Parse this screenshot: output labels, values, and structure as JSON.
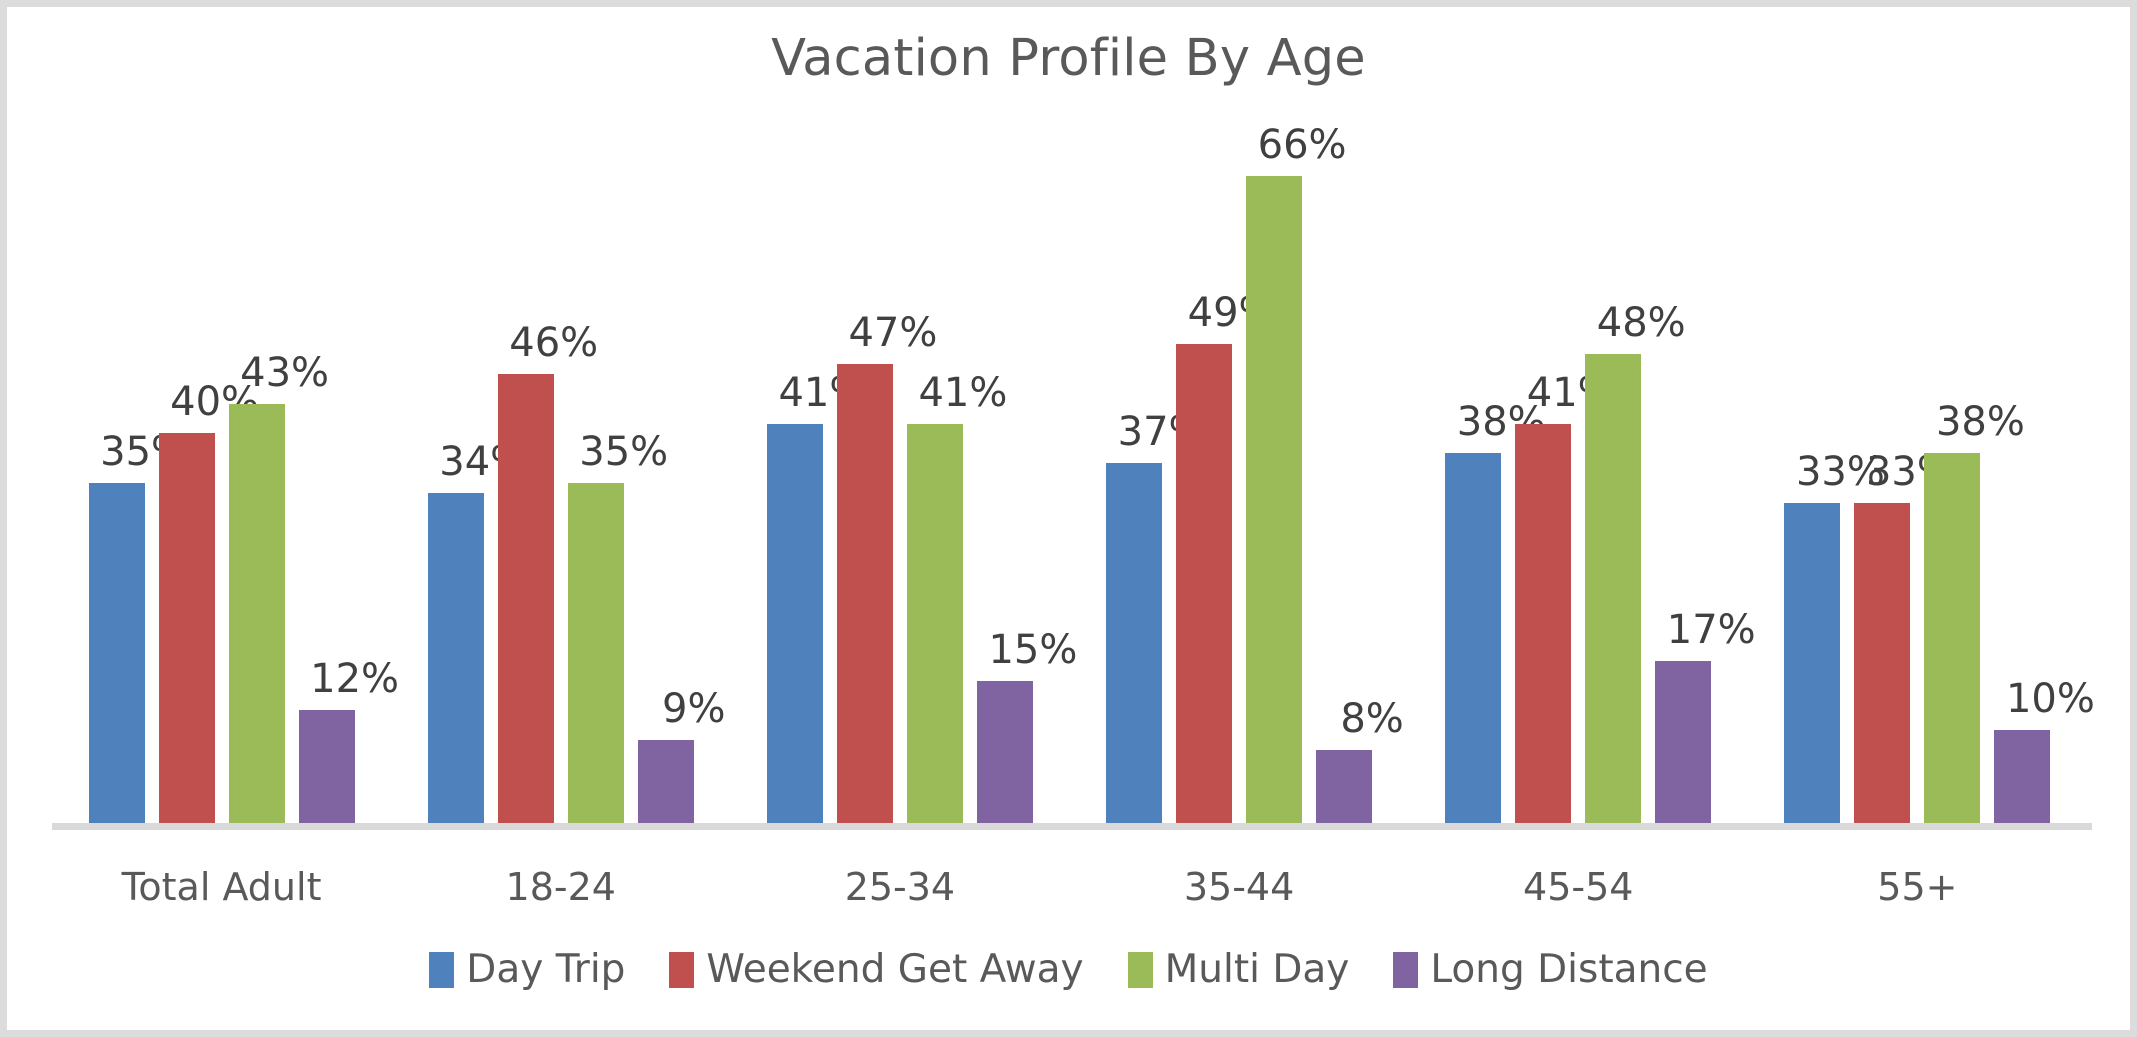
{
  "chart_data": {
    "type": "bar",
    "title": "Vacation Profile By Age",
    "xlabel": "",
    "ylabel": "",
    "ylim": [
      0,
      72
    ],
    "grid": false,
    "legend_position": "bottom",
    "value_suffix": "%",
    "categories": [
      "Total Adult",
      "18-24",
      "25-34",
      "35-44",
      "45-54",
      "55+"
    ],
    "series": [
      {
        "name": "Day Trip",
        "color": "#4f81bd",
        "values": [
          35,
          34,
          41,
          37,
          38,
          33
        ]
      },
      {
        "name": "Weekend Get Away",
        "color": "#c0504d",
        "values": [
          40,
          46,
          47,
          49,
          41,
          33
        ]
      },
      {
        "name": "Multi Day",
        "color": "#9bbb59",
        "values": [
          43,
          35,
          41,
          66,
          48,
          38
        ]
      },
      {
        "name": "Long Distance",
        "color": "#8064a2",
        "values": [
          12,
          9,
          15,
          8,
          17,
          10
        ]
      }
    ],
    "data_labels": [
      [
        "35%",
        "40%",
        "43%",
        "12%"
      ],
      [
        "34%",
        "46%",
        "35%",
        "9%"
      ],
      [
        "41%",
        "47%",
        "41%",
        "15%"
      ],
      [
        "37%",
        "49%",
        "66%",
        "8%"
      ],
      [
        "38%",
        "41%",
        "48%",
        "17%"
      ],
      [
        "33%",
        "33%",
        "38%",
        "10%"
      ]
    ]
  },
  "legend": {
    "items": [
      {
        "label": "Day Trip",
        "color": "#4f81bd"
      },
      {
        "label": "Weekend Get Away",
        "color": "#c0504d"
      },
      {
        "label": "Multi Day",
        "color": "#9bbb59"
      },
      {
        "label": "Long Distance",
        "color": "#8064a2"
      }
    ]
  },
  "colors": {
    "title_text": "#595959",
    "label_text": "#404040",
    "axis_line": "#d9d9d9",
    "frame_border": "#dcdcdc",
    "background": "#ffffff"
  }
}
